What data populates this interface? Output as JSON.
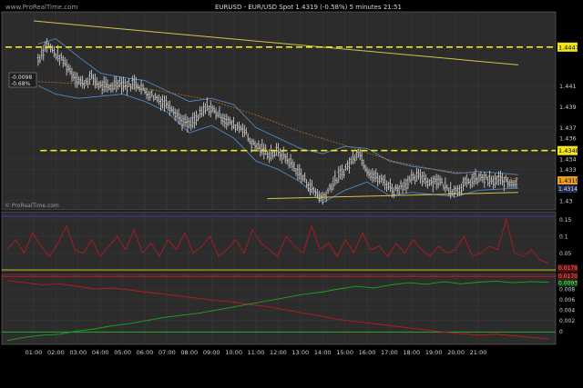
{
  "header": {
    "watermark": "www.ProRealTime.com",
    "title": "EURUSD - EUR/USD Spot   1.4319 (-0.58%)   5 minutes  21:51"
  },
  "main_panel": {
    "footer_watermark": "© ProRealTime.com",
    "annotation_line1": "-0.0098",
    "annotation_line2": "-0.68%"
  },
  "chart_data": [
    {
      "type": "line",
      "panel": "price",
      "x_tick_labels": [
        "01:00",
        "02:00",
        "03:00",
        "04:00",
        "05:00",
        "06:00",
        "07:00",
        "08:00",
        "09:00",
        "10:00",
        "11:00",
        "12:00",
        "13:00",
        "14:00",
        "15:00",
        "16:00",
        "17:00",
        "18:00",
        "19:00",
        "20:00",
        "21:00"
      ],
      "y_tick_labels": [
        "1.441",
        "1.439",
        "1.437",
        "1.436",
        "1.434",
        "1.433",
        "1.431",
        "1.43"
      ],
      "y_tick_values": [
        1.441,
        1.439,
        1.437,
        1.436,
        1.434,
        1.433,
        1.431,
        1.43
      ],
      "ylim": [
        1.4293,
        1.4479
      ],
      "highlighted_levels": [
        {
          "label": "1.4447",
          "value": 1.4447,
          "style": "dashed-yellow"
        },
        {
          "label": "1.4348",
          "value": 1.4348,
          "style": "dashed-yellow"
        }
      ],
      "current_price_label": "1.4319",
      "secondary_price_label": "1.4314",
      "trendlines": [
        {
          "from": [
            0,
            1.4472
          ],
          "to": [
            21.8,
            1.443
          ],
          "color": "#d4c24a"
        },
        {
          "from": [
            10.5,
            1.4302
          ],
          "to": [
            21.8,
            1.4308
          ],
          "color": "#d4c24a"
        }
      ],
      "price_series": [
        [
          0.2,
          1.4435
        ],
        [
          0.6,
          1.445
        ],
        [
          1.0,
          1.444
        ],
        [
          1.4,
          1.4432
        ],
        [
          1.8,
          1.442
        ],
        [
          2.2,
          1.4412
        ],
        [
          2.6,
          1.4418
        ],
        [
          3.0,
          1.441
        ],
        [
          3.4,
          1.4408
        ],
        [
          3.8,
          1.4414
        ],
        [
          4.2,
          1.441
        ],
        [
          4.6,
          1.4413
        ],
        [
          5.0,
          1.4405
        ],
        [
          5.4,
          1.44
        ],
        [
          5.8,
          1.4395
        ],
        [
          6.2,
          1.439
        ],
        [
          6.6,
          1.4378
        ],
        [
          7.0,
          1.4372
        ],
        [
          7.4,
          1.438
        ],
        [
          7.8,
          1.439
        ],
        [
          8.2,
          1.4385
        ],
        [
          8.6,
          1.4378
        ],
        [
          9.0,
          1.4372
        ],
        [
          9.4,
          1.437
        ],
        [
          9.8,
          1.4355
        ],
        [
          10.2,
          1.435
        ],
        [
          10.6,
          1.4345
        ],
        [
          11.0,
          1.4347
        ],
        [
          11.4,
          1.434
        ],
        [
          11.8,
          1.433
        ],
        [
          12.2,
          1.432
        ],
        [
          12.6,
          1.431
        ],
        [
          13.0,
          1.4302
        ],
        [
          13.4,
          1.4315
        ],
        [
          13.8,
          1.4325
        ],
        [
          14.2,
          1.4335
        ],
        [
          14.6,
          1.4348
        ],
        [
          15.0,
          1.433
        ],
        [
          15.4,
          1.4322
        ],
        [
          15.8,
          1.4318
        ],
        [
          16.2,
          1.431
        ],
        [
          16.6,
          1.4315
        ],
        [
          17.0,
          1.432
        ],
        [
          17.4,
          1.4324
        ],
        [
          17.8,
          1.4318
        ],
        [
          18.2,
          1.432
        ],
        [
          18.6,
          1.4312
        ],
        [
          19.0,
          1.431
        ],
        [
          19.4,
          1.4316
        ],
        [
          19.8,
          1.432
        ],
        [
          20.2,
          1.4322
        ],
        [
          20.6,
          1.4318
        ],
        [
          21.0,
          1.432
        ],
        [
          21.4,
          1.4317
        ],
        [
          21.8,
          1.4319
        ]
      ],
      "moving_average": [
        [
          0.2,
          1.4414
        ],
        [
          2,
          1.4412
        ],
        [
          4,
          1.441
        ],
        [
          6,
          1.4404
        ],
        [
          8,
          1.4396
        ],
        [
          10,
          1.4382
        ],
        [
          12,
          1.4366
        ],
        [
          14,
          1.4353
        ],
        [
          16,
          1.4339
        ],
        [
          18,
          1.433
        ],
        [
          20,
          1.4325
        ],
        [
          21.8,
          1.4321
        ]
      ],
      "bollinger_upper": [
        [
          0.2,
          1.445
        ],
        [
          1.0,
          1.4455
        ],
        [
          2,
          1.4438
        ],
        [
          3,
          1.4422
        ],
        [
          4,
          1.4418
        ],
        [
          5,
          1.4415
        ],
        [
          6,
          1.4405
        ],
        [
          7,
          1.4395
        ],
        [
          8,
          1.4398
        ],
        [
          9,
          1.4392
        ],
        [
          10,
          1.437
        ],
        [
          11,
          1.436
        ],
        [
          12,
          1.435
        ],
        [
          13,
          1.4345
        ],
        [
          14,
          1.4352
        ],
        [
          15,
          1.435
        ],
        [
          16,
          1.4338
        ],
        [
          17,
          1.4333
        ],
        [
          18,
          1.433
        ],
        [
          19,
          1.4326
        ],
        [
          20,
          1.4328
        ],
        [
          21.8,
          1.4325
        ]
      ],
      "bollinger_lower": [
        [
          0.2,
          1.441
        ],
        [
          1.0,
          1.4402
        ],
        [
          2,
          1.4398
        ],
        [
          3,
          1.44
        ],
        [
          4,
          1.4402
        ],
        [
          5,
          1.4395
        ],
        [
          6,
          1.4385
        ],
        [
          7,
          1.4365
        ],
        [
          8,
          1.4372
        ],
        [
          9,
          1.436
        ],
        [
          10,
          1.4338
        ],
        [
          11,
          1.433
        ],
        [
          12,
          1.4318
        ],
        [
          13,
          1.4298
        ],
        [
          14,
          1.431
        ],
        [
          15,
          1.4318
        ],
        [
          16,
          1.4305
        ],
        [
          17,
          1.4308
        ],
        [
          18,
          1.4306
        ],
        [
          19,
          1.4304
        ],
        [
          20,
          1.431
        ],
        [
          21.8,
          1.4312
        ]
      ]
    },
    {
      "type": "line",
      "panel": "volatility",
      "series": [
        {
          "color": "#c0191e",
          "values": [
            0.06,
            0.09,
            0.05,
            0.11,
            0.07,
            0.04,
            0.08,
            0.13,
            0.06,
            0.05,
            0.09,
            0.04,
            0.07,
            0.1,
            0.06,
            0.12,
            0.05,
            0.08,
            0.04,
            0.09,
            0.06,
            0.11,
            0.05,
            0.07,
            0.1,
            0.04,
            0.06,
            0.09,
            0.05,
            0.12,
            0.08,
            0.06,
            0.04,
            0.1,
            0.07,
            0.05,
            0.13,
            0.06,
            0.08,
            0.04,
            0.09,
            0.05,
            0.11,
            0.06,
            0.07,
            0.04,
            0.08,
            0.05,
            0.09,
            0.06,
            0.04,
            0.07,
            0.05,
            0.06,
            0.1,
            0.04,
            0.05,
            0.07,
            0.06,
            0.15,
            0.05,
            0.04,
            0.06,
            0.03,
            0.02
          ]
        }
      ],
      "y_tick_labels": [
        "0.15",
        "0.1",
        "0.05"
      ],
      "y_tick_values": [
        0.15,
        0.1,
        0.05
      ],
      "ylim": [
        0,
        0.165
      ],
      "current_value_label": "0.0179"
    },
    {
      "type": "line",
      "panel": "momentum",
      "series": [
        {
          "color": "#c0191e",
          "values": [
            0.0096,
            0.0092,
            0.0088,
            0.009,
            0.0085,
            0.008,
            0.0082,
            0.0078,
            0.0074,
            0.007,
            0.0066,
            0.0062,
            0.0058,
            0.0055,
            0.005,
            0.0046,
            0.004,
            0.0034,
            0.0028,
            0.0022,
            0.0018,
            0.0014,
            0.001,
            0.0006,
            0.0002,
            -0.0002,
            -0.0005,
            -0.0008,
            -0.0006,
            -0.0009,
            -0.0012,
            -0.0015
          ]
        },
        {
          "color": "#1fa31f",
          "values": [
            -0.0018,
            -0.0012,
            -0.0008,
            -0.0006,
            0.0,
            0.0004,
            0.001,
            0.0014,
            0.002,
            0.0026,
            0.003,
            0.0034,
            0.004,
            0.0046,
            0.0052,
            0.0058,
            0.0064,
            0.007,
            0.0074,
            0.008,
            0.0085,
            0.0082,
            0.0088,
            0.0092,
            0.0089,
            0.0094,
            0.009,
            0.0093,
            0.0095,
            0.0092,
            0.0094,
            0.0093
          ]
        }
      ],
      "y_tick_labels": [
        "0.008",
        "0.006",
        "0.004",
        "0.002",
        "0"
      ],
      "y_tick_values": [
        0.008,
        0.006,
        0.004,
        0.002,
        0
      ],
      "ylim": [
        -0.0022,
        0.0106
      ],
      "value_labels": [
        "0.0170",
        "0.0093"
      ]
    }
  ],
  "colors": {
    "panel_bg": "#2c2c2c",
    "grid": "#3b3b3b",
    "candles": "#d9d9d9",
    "trendline": "#d4c24a",
    "level_line": "#f2e419",
    "ma": "#b5701f",
    "bollinger": "#4f88c9",
    "border": "#6a6a6a"
  }
}
